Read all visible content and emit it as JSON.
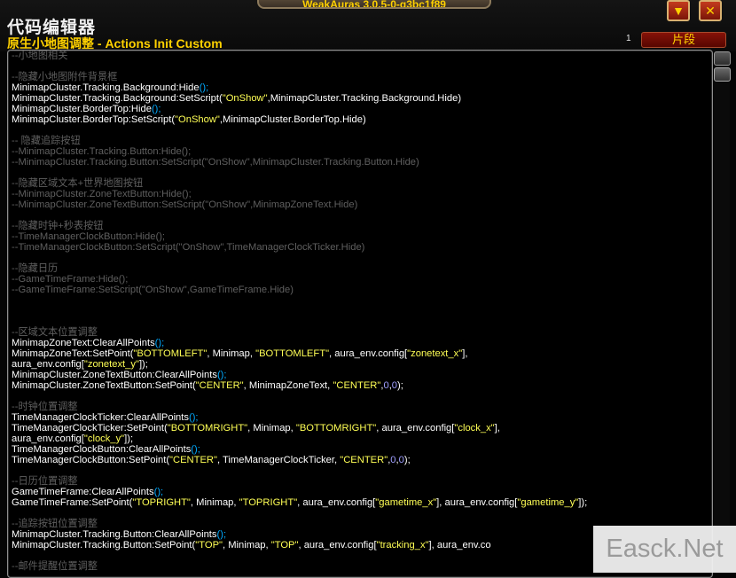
{
  "window": {
    "title": "代码编辑器",
    "aura_name": "原生小地图调整 - Actions Init Custom",
    "top_frame_text": "WeakAuras 3.0.5-0-g3bc1f89",
    "minimize_glyph": "▼",
    "close_glyph": "✕"
  },
  "toolbar": {
    "line_count": "1",
    "snippets_label": "片段"
  },
  "colors": {
    "comment": "#5f5f5f",
    "code": "#ffffff",
    "punct": "#00aaff",
    "string": "#ffff55",
    "number": "#9f9fff",
    "title": "#ffd100"
  },
  "code_lines": [
    [
      {
        "t": "c",
        "v": "--小地图相关"
      }
    ],
    [],
    [
      {
        "t": "c",
        "v": "--隐藏小地图附件背景框"
      }
    ],
    [
      {
        "t": "p",
        "v": "MinimapCluster.Tracking.Background:Hide"
      },
      {
        "t": "sc",
        "v": "();"
      }
    ],
    [
      {
        "t": "p",
        "v": "MinimapCluster.Tracking.Background:SetScript("
      },
      {
        "t": "s",
        "v": "\"OnShow\""
      },
      {
        "t": "p",
        "v": ",MinimapCluster.Tracking.Background.Hide)"
      }
    ],
    [
      {
        "t": "p",
        "v": "MinimapCluster.BorderTop:Hide"
      },
      {
        "t": "sc",
        "v": "();"
      }
    ],
    [
      {
        "t": "p",
        "v": "MinimapCluster.BorderTop:SetScript("
      },
      {
        "t": "s",
        "v": "\"OnShow\""
      },
      {
        "t": "p",
        "v": ",MinimapCluster.BorderTop.Hide)"
      }
    ],
    [],
    [
      {
        "t": "c",
        "v": "-- 隐藏追踪按钮"
      }
    ],
    [
      {
        "t": "c",
        "v": "--MinimapCluster.Tracking.Button:Hide();"
      }
    ],
    [
      {
        "t": "c",
        "v": "--MinimapCluster.Tracking.Button:SetScript(\"OnShow\",MinimapCluster.Tracking.Button.Hide)"
      }
    ],
    [],
    [
      {
        "t": "c",
        "v": "--隐藏区域文本+世界地图按钮"
      }
    ],
    [
      {
        "t": "c",
        "v": "--MinimapCluster.ZoneTextButton:Hide();"
      }
    ],
    [
      {
        "t": "c",
        "v": "--MinimapCluster.ZoneTextButton:SetScript(\"OnShow\",MinimapZoneText.Hide)"
      }
    ],
    [],
    [
      {
        "t": "c",
        "v": "--隐藏时钟+秒表按钮"
      }
    ],
    [
      {
        "t": "c",
        "v": "--TimeManagerClockButton:Hide();"
      }
    ],
    [
      {
        "t": "c",
        "v": "--TimeManagerClockButton:SetScript(\"OnShow\",TimeManagerClockTicker.Hide)"
      }
    ],
    [],
    [
      {
        "t": "c",
        "v": "--隐藏日历"
      }
    ],
    [
      {
        "t": "c",
        "v": "--GameTimeFrame:Hide();"
      }
    ],
    [
      {
        "t": "c",
        "v": "--GameTimeFrame:SetScript(\"OnShow\",GameTimeFrame.Hide)"
      }
    ],
    [],
    [],
    [],
    [
      {
        "t": "c",
        "v": "--区域文本位置调整"
      }
    ],
    [
      {
        "t": "p",
        "v": "MinimapZoneText:ClearAllPoints"
      },
      {
        "t": "sc",
        "v": "();"
      }
    ],
    [
      {
        "t": "p",
        "v": "MinimapZoneText:SetPoint("
      },
      {
        "t": "s",
        "v": "\"BOTTOMLEFT\""
      },
      {
        "t": "p",
        "v": ", Minimap, "
      },
      {
        "t": "s",
        "v": "\"BOTTOMLEFT\""
      },
      {
        "t": "p",
        "v": ", aura_env.config["
      },
      {
        "t": "s",
        "v": "\"zonetext_x\""
      },
      {
        "t": "p",
        "v": "],"
      }
    ],
    [
      {
        "t": "p",
        "v": "aura_env.config["
      },
      {
        "t": "s",
        "v": "\"zonetext_y\""
      },
      {
        "t": "p",
        "v": "]);"
      }
    ],
    [
      {
        "t": "p",
        "v": "MinimapCluster.ZoneTextButton:ClearAllPoints"
      },
      {
        "t": "sc",
        "v": "();"
      }
    ],
    [
      {
        "t": "p",
        "v": "MinimapCluster.ZoneTextButton:SetPoint("
      },
      {
        "t": "s",
        "v": "\"CENTER\""
      },
      {
        "t": "p",
        "v": ", MinimapZoneText, "
      },
      {
        "t": "s",
        "v": "\"CENTER\""
      },
      {
        "t": "p",
        "v": ","
      },
      {
        "t": "n",
        "v": "0"
      },
      {
        "t": "p",
        "v": ","
      },
      {
        "t": "n",
        "v": "0"
      },
      {
        "t": "p",
        "v": ");"
      }
    ],
    [],
    [
      {
        "t": "c",
        "v": "--时钟位置调整"
      }
    ],
    [
      {
        "t": "p",
        "v": "TimeManagerClockTicker:ClearAllPoints"
      },
      {
        "t": "sc",
        "v": "();"
      }
    ],
    [
      {
        "t": "p",
        "v": "TimeManagerClockTicker:SetPoint("
      },
      {
        "t": "s",
        "v": "\"BOTTOMRIGHT\""
      },
      {
        "t": "p",
        "v": ", Minimap, "
      },
      {
        "t": "s",
        "v": "\"BOTTOMRIGHT\""
      },
      {
        "t": "p",
        "v": ", aura_env.config["
      },
      {
        "t": "s",
        "v": "\"clock_x\""
      },
      {
        "t": "p",
        "v": "],"
      }
    ],
    [
      {
        "t": "p",
        "v": "aura_env.config["
      },
      {
        "t": "s",
        "v": "\"clock_y\""
      },
      {
        "t": "p",
        "v": "]);"
      }
    ],
    [
      {
        "t": "p",
        "v": "TimeManagerClockButton:ClearAllPoints"
      },
      {
        "t": "sc",
        "v": "();"
      }
    ],
    [
      {
        "t": "p",
        "v": "TimeManagerClockButton:SetPoint("
      },
      {
        "t": "s",
        "v": "\"CENTER\""
      },
      {
        "t": "p",
        "v": ", TimeManagerClockTicker, "
      },
      {
        "t": "s",
        "v": "\"CENTER\""
      },
      {
        "t": "p",
        "v": ","
      },
      {
        "t": "n",
        "v": "0"
      },
      {
        "t": "p",
        "v": ","
      },
      {
        "t": "n",
        "v": "0"
      },
      {
        "t": "p",
        "v": ");"
      }
    ],
    [],
    [
      {
        "t": "c",
        "v": "--日历位置调整"
      }
    ],
    [
      {
        "t": "p",
        "v": "GameTimeFrame:ClearAllPoints"
      },
      {
        "t": "sc",
        "v": "();"
      }
    ],
    [
      {
        "t": "p",
        "v": "GameTimeFrame:SetPoint("
      },
      {
        "t": "s",
        "v": "\"TOPRIGHT\""
      },
      {
        "t": "p",
        "v": ", Minimap, "
      },
      {
        "t": "s",
        "v": "\"TOPRIGHT\""
      },
      {
        "t": "p",
        "v": ", aura_env.config["
      },
      {
        "t": "s",
        "v": "\"gametime_x\""
      },
      {
        "t": "p",
        "v": "], aura_env.config["
      },
      {
        "t": "s",
        "v": "\"gametime_y\""
      },
      {
        "t": "p",
        "v": "]);"
      }
    ],
    [],
    [
      {
        "t": "c",
        "v": "--追踪按钮位置调整"
      }
    ],
    [
      {
        "t": "p",
        "v": "MinimapCluster.Tracking.Button:ClearAllPoints"
      },
      {
        "t": "sc",
        "v": "();"
      }
    ],
    [
      {
        "t": "p",
        "v": "MinimapCluster.Tracking.Button:SetPoint("
      },
      {
        "t": "s",
        "v": "\"TOP\""
      },
      {
        "t": "p",
        "v": ", Minimap, "
      },
      {
        "t": "s",
        "v": "\"TOP\""
      },
      {
        "t": "p",
        "v": ", aura_env.config["
      },
      {
        "t": "s",
        "v": "\"tracking_x\""
      },
      {
        "t": "p",
        "v": "], aura_env.co"
      }
    ],
    [],
    [
      {
        "t": "c",
        "v": "--邮件提醒位置调整"
      }
    ]
  ],
  "watermark": "Easck.Net"
}
